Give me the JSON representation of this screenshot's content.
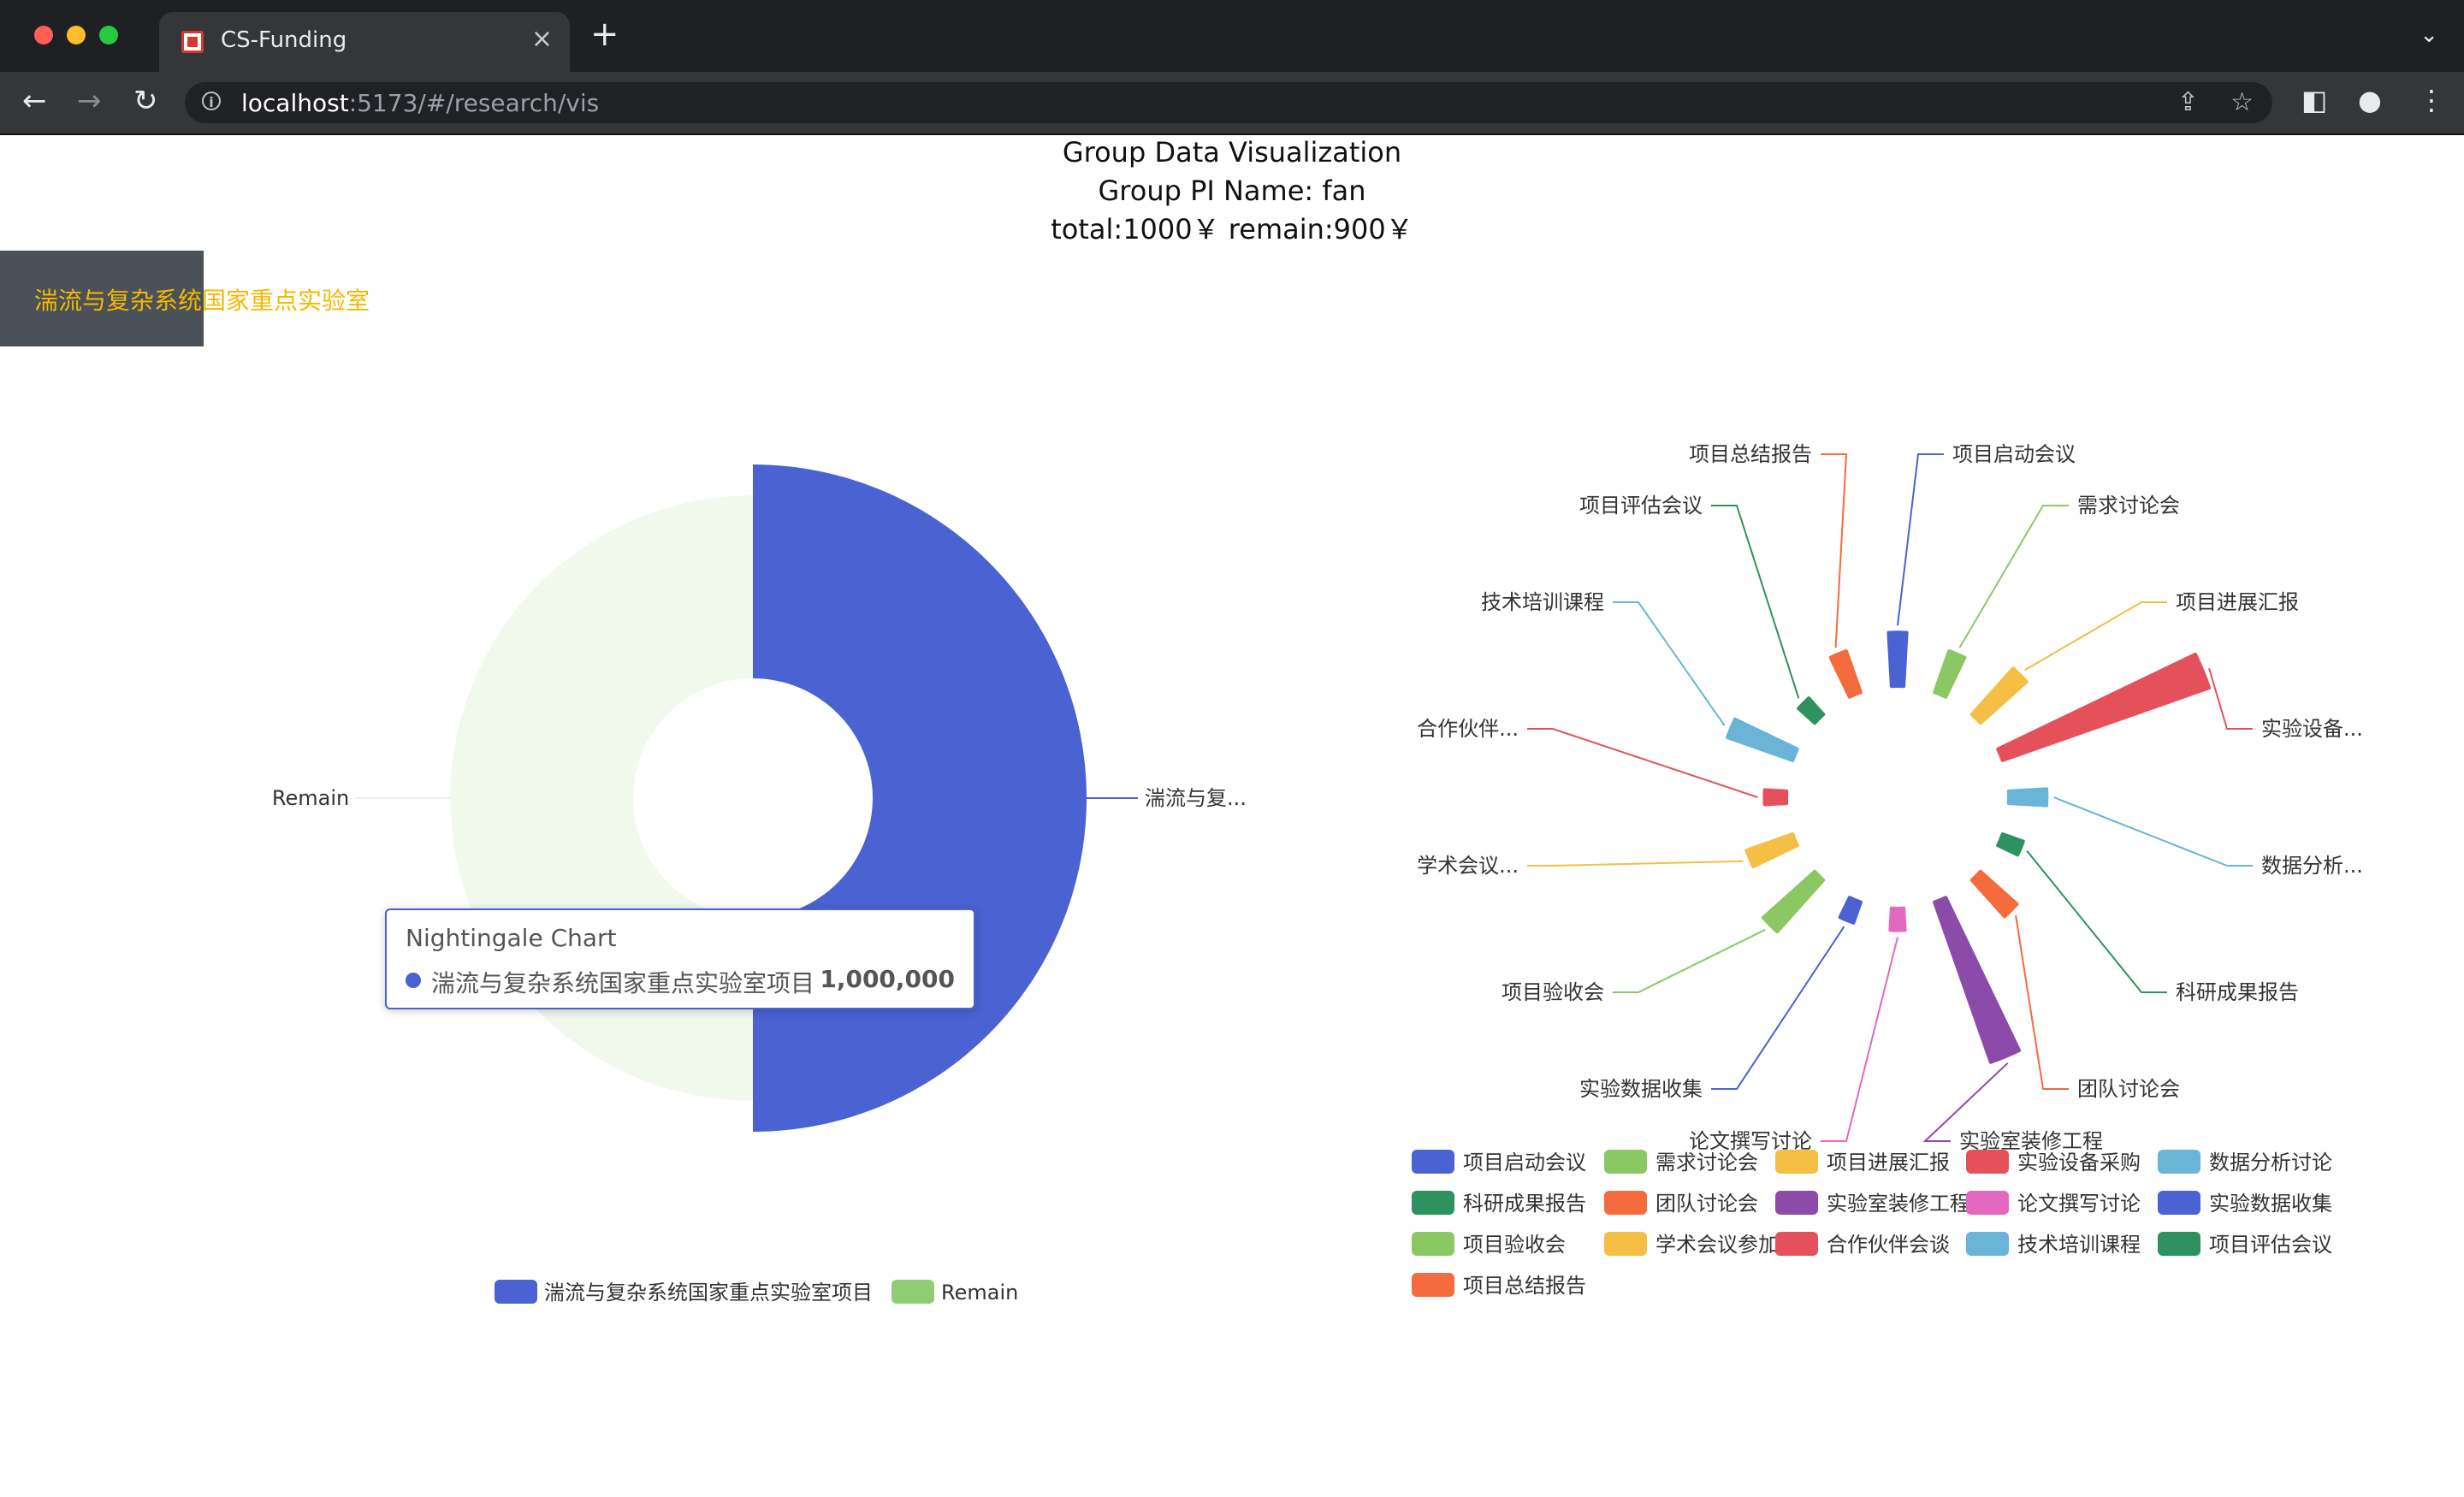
{
  "browser": {
    "tab_title": "CS-Funding",
    "url_host": "localhost",
    "url_path": ":5173/#/research/vis",
    "light_colors": [
      "#ff5f57",
      "#febc2e",
      "#28c840"
    ]
  },
  "header": {
    "title": "Group Data Visualization",
    "pi_line": "Group PI Name: fan",
    "totals_line": "total:1000￥ remain:900￥"
  },
  "lab_tab": {
    "label": "湍流与复杂系统国家重点实验室"
  },
  "tooltip": {
    "title": "Nightingale Chart",
    "name": "湍流与复杂系统国家重点实验室项目",
    "value": "1,000,000"
  },
  "chart_data": [
    {
      "type": "pie",
      "variant": "nightingale-rose",
      "title": "Nightingale Chart",
      "slices": [
        {
          "name": "湍流与复杂系统国家重点实验室项目",
          "label": "湍流与复...",
          "value": 1000000,
          "color": "#4a62d2",
          "radius_frac": 1.0
        },
        {
          "name": "Remain",
          "label": "Remain",
          "value": 900,
          "color": "#91cc75",
          "radius_frac": 0.855
        }
      ],
      "legend": [
        "湍流与复杂系统国家重点实验室项目",
        "Remain"
      ],
      "legend_position": "bottom-center"
    },
    {
      "type": "pie",
      "variant": "nightingale-rose",
      "slices": [
        {
          "name": "项目启动会议",
          "label": "项目启动会议",
          "value": 6,
          "color": "#4a62d2"
        },
        {
          "name": "需求讨论会",
          "label": "需求讨论会",
          "value": 4,
          "color": "#8bc864"
        },
        {
          "name": "项目进展汇报",
          "label": "项目进展汇报",
          "value": 8,
          "color": "#f5be45"
        },
        {
          "name": "实验设备采购",
          "label": "实验设备...",
          "value": 100,
          "color": "#e5515b"
        },
        {
          "name": "数据分析讨论",
          "label": "数据分析...",
          "value": 3,
          "color": "#6ab4d8"
        },
        {
          "name": "科研成果报告",
          "label": "科研成果报告",
          "value": 1,
          "color": "#2e9160"
        },
        {
          "name": "团队讨论会",
          "label": "团队讨论会",
          "value": 5,
          "color": "#f46b3d"
        },
        {
          "name": "实验室装修工程",
          "label": "实验室装修工程",
          "value": 60,
          "color": "#8c4ba8"
        },
        {
          "name": "论文撰写讨论",
          "label": "论文撰写讨论",
          "value": 1,
          "color": "#e467c0"
        },
        {
          "name": "实验数据收集",
          "label": "实验数据收集",
          "value": 1,
          "color": "#4a62d2"
        },
        {
          "name": "项目验收会",
          "label": "项目验收会",
          "value": 10,
          "color": "#8bc864"
        },
        {
          "name": "学术会议参加",
          "label": "学术会议...",
          "value": 5,
          "color": "#f5be45"
        },
        {
          "name": "合作伙伴会谈",
          "label": "合作伙伴...",
          "value": 1,
          "color": "#e5515b"
        },
        {
          "name": "技术培训课程",
          "label": "技术培训课程",
          "value": 10,
          "color": "#6ab4d8"
        },
        {
          "name": "项目评估会议",
          "label": "项目评估会议",
          "value": 1,
          "color": "#2e9160"
        },
        {
          "name": "项目总结报告",
          "label": "项目总结报告",
          "value": 4,
          "color": "#f46b3d"
        }
      ],
      "legend_position": "bottom"
    }
  ]
}
